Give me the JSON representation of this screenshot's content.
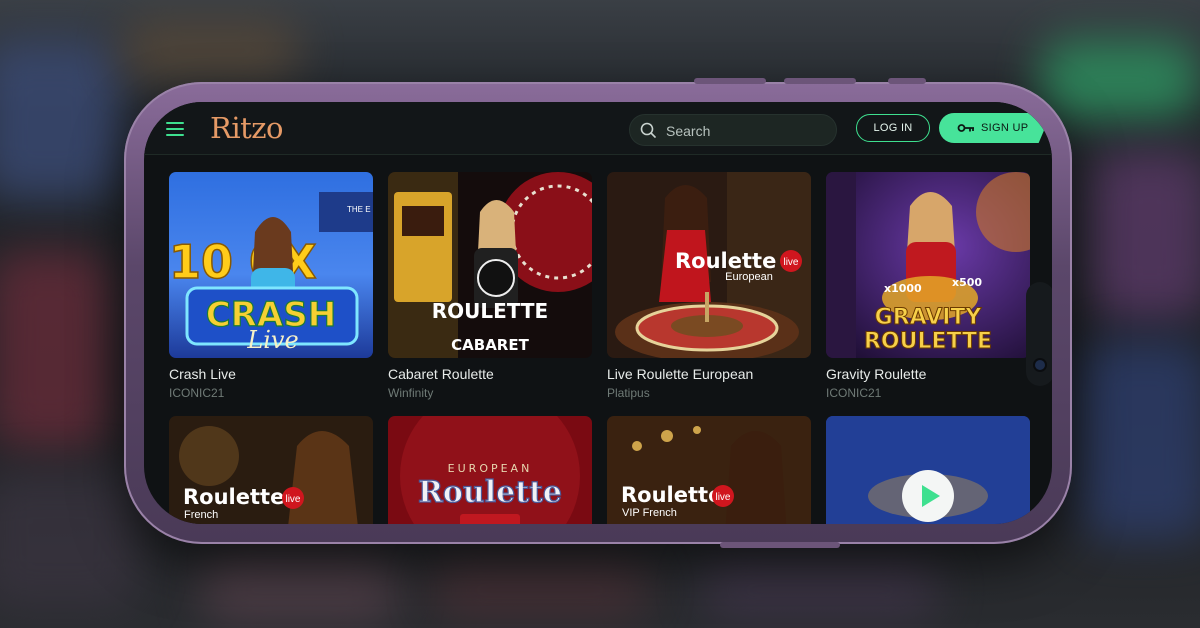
{
  "app": {
    "logo": "Ritzo"
  },
  "header": {
    "menu_icon": "hamburger-menu-icon",
    "search_placeholder": "Search",
    "login_label": "LOG IN",
    "signup_label": "SIGN UP",
    "signup_icon": "key-icon"
  },
  "games": [
    {
      "title": "Crash Live",
      "provider": "ICONIC21",
      "art_text": "CRASH",
      "art_sub": "Live",
      "art_big": "10  0X",
      "art_board": "THE E"
    },
    {
      "title": "Cabaret Roulette",
      "provider": "Winfinity",
      "art_text": "ROULETTE",
      "art_sub": "CABARET"
    },
    {
      "title": "Live Roulette European",
      "provider": "Platipus",
      "art_text": "Roulette",
      "art_sub": "European",
      "badge": "live"
    },
    {
      "title": "Gravity Roulette",
      "provider": "ICONIC21",
      "art_text": "GRAVITY",
      "art_sub": "ROULETTE",
      "mult1": "x1000",
      "mult2": "x500"
    },
    {
      "art_text": "Roulette",
      "art_sub": "French",
      "badge": "live"
    },
    {
      "art_text": "Roulette",
      "art_top": "EUROPEAN"
    },
    {
      "art_text": "Roulette",
      "art_sub": "VIP French",
      "badge": "live"
    },
    {
      "play_icon": "play-icon"
    }
  ],
  "colors": {
    "accent": "#47e39a",
    "logo": "#e59a66",
    "background": "#0f1214",
    "live_badge": "#d0161e"
  }
}
